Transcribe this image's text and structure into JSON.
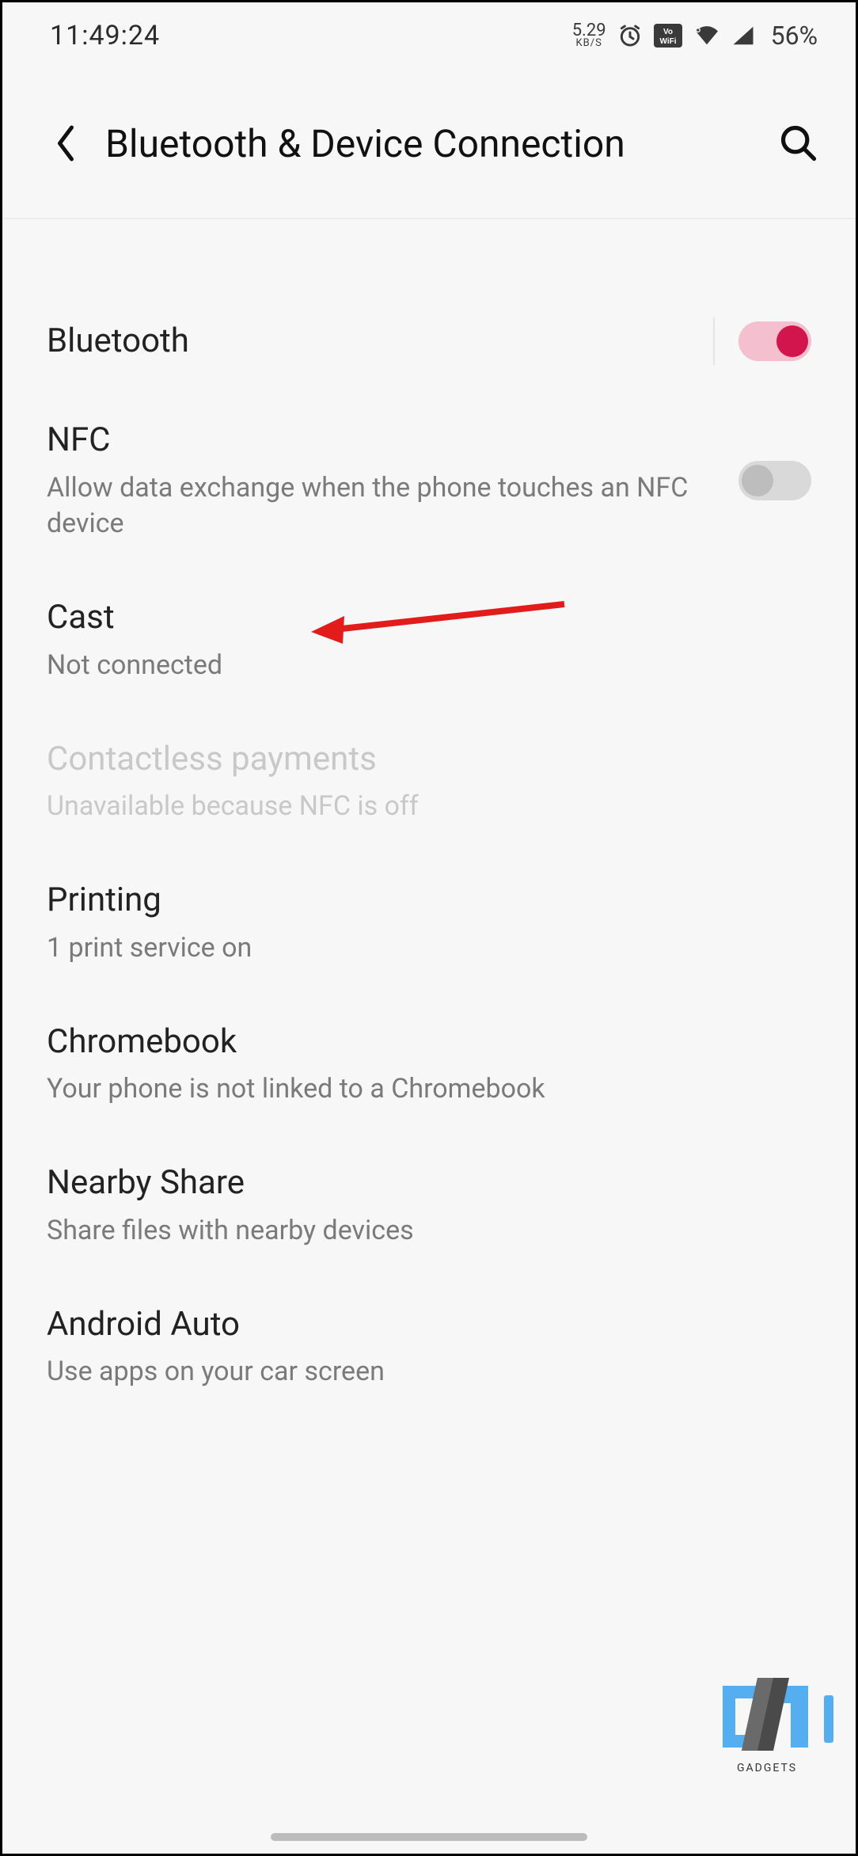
{
  "status": {
    "time": "11:49:24",
    "kbs_value": "5.29",
    "kbs_unit": "KB/S",
    "battery": "56%"
  },
  "header": {
    "title": "Bluetooth & Device Connection"
  },
  "settings": [
    {
      "key": "bluetooth",
      "title": "Bluetooth",
      "subtitle": "",
      "toggle": "on",
      "disabled": false,
      "separator": true
    },
    {
      "key": "nfc",
      "title": "NFC",
      "subtitle": "Allow data exchange when the phone touches an NFC device",
      "toggle": "off",
      "disabled": false
    },
    {
      "key": "cast",
      "title": "Cast",
      "subtitle": "Not connected",
      "toggle": null,
      "disabled": false
    },
    {
      "key": "contactless",
      "title": "Contactless payments",
      "subtitle": "Unavailable because NFC is off",
      "toggle": null,
      "disabled": true
    },
    {
      "key": "printing",
      "title": "Printing",
      "subtitle": "1 print service on",
      "toggle": null,
      "disabled": false
    },
    {
      "key": "chromebook",
      "title": "Chromebook",
      "subtitle": "Your phone is not linked to a Chromebook",
      "toggle": null,
      "disabled": false
    },
    {
      "key": "nearby",
      "title": "Nearby Share",
      "subtitle": "Share files with nearby devices",
      "toggle": null,
      "disabled": false
    },
    {
      "key": "androidauto",
      "title": "Android Auto",
      "subtitle": "Use apps on your car screen",
      "toggle": null,
      "disabled": false
    }
  ],
  "watermark": {
    "text": "GADGETS"
  },
  "annotation": {
    "arrow_color": "#e21b1b"
  }
}
